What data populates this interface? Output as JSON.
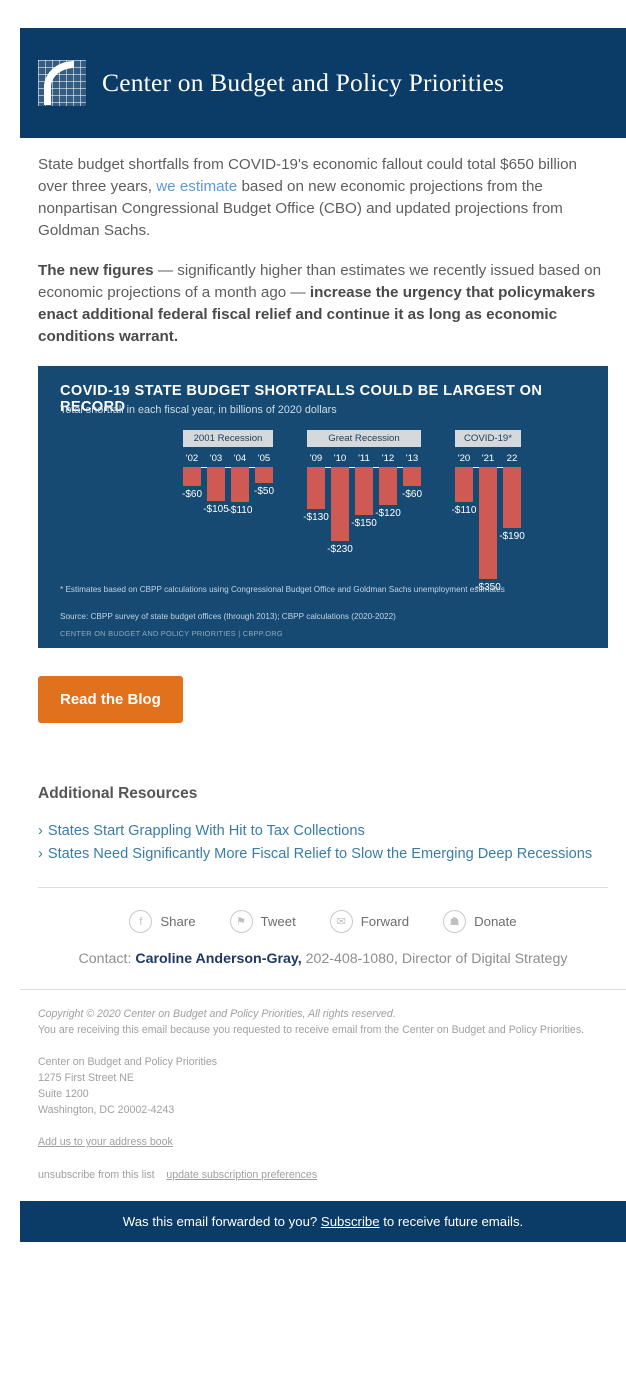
{
  "header": {
    "org_name": "Center on Budget and Policy Priorities",
    "logo_icon": "cbpp-grid-arc-logo"
  },
  "body": {
    "para1_a": "State budget shortfalls from COVID-19's economic fallout could total $650 billion over three years, ",
    "para1_link": "we estimate",
    "para1_b": " based on new economic projections from the nonpartisan Congressional Budget Office (CBO) and updated projections from Goldman Sachs.",
    "para2_bold1": "The new figures",
    "para2_mid": " — significantly higher than estimates we recently issued based on economic projections of a month ago — ",
    "para2_bold2": "increase the urgency that policymakers enact additional federal fiscal relief and continue it as long as economic conditions warrant."
  },
  "cta": {
    "label": "Read the Blog"
  },
  "resources": {
    "title": "Additional Resources",
    "chevron": "›",
    "items": [
      "States Start Grappling With Hit to Tax Collections",
      "States Need Significantly More Fiscal Relief to Slow the Emerging Deep Recessions"
    ]
  },
  "social": [
    {
      "label": "Share",
      "icon": "facebook-icon",
      "glyph": "f"
    },
    {
      "label": "Tweet",
      "icon": "twitter-icon",
      "glyph": "⚑"
    },
    {
      "label": "Forward",
      "icon": "envelope-icon",
      "glyph": "✉"
    },
    {
      "label": "Donate",
      "icon": "gift-icon",
      "glyph": "☗"
    }
  ],
  "contact": {
    "prefix": "Contact: ",
    "name": "Caroline Anderson-Gray,",
    "suffix": " 202-408-1080, Director of Digital Strategy"
  },
  "footer": {
    "copyright": "Copyright © 2020 Center on Budget and Policy Priorities, All rights reserved.",
    "reason": "You are receiving this email because you requested to receive email from the Center on Budget and Policy Priorities.",
    "address": [
      "Center on Budget and Policy Priorities",
      "1275 First Street NE",
      "Suite 1200",
      "Washington, DC 20002-4243"
    ],
    "address_book_link": "Add us to your address book",
    "unsubscribe": "unsubscribe from this list",
    "preferences": "update subscription preferences"
  },
  "banner": {
    "before": "Was this email forwarded to you? ",
    "link": "Subscribe",
    "after": " to receive future emails."
  },
  "chart_data": {
    "type": "bar",
    "title": "COVID-19 STATE BUDGET SHORTFALLS COULD BE LARGEST ON RECORD",
    "subtitle": "Total shortfall in each fiscal year, in billions of 2020 dollars",
    "xlabel": "",
    "ylabel": "",
    "ylim": [
      -350,
      0
    ],
    "grid": false,
    "bar_color": "#cf5a54",
    "background_color": "#164a73",
    "groups": [
      {
        "name": "2001 Recession",
        "categories": [
          "'02",
          "'03",
          "'04",
          "'05"
        ],
        "values": [
          -60,
          -105,
          -110,
          -50
        ],
        "labels": [
          "-$60",
          "-$105",
          "-$110",
          "-$50"
        ]
      },
      {
        "name": "Great Recession",
        "categories": [
          "'09",
          "'10",
          "'11",
          "'12",
          "'13"
        ],
        "values": [
          -130,
          -230,
          -150,
          -120,
          -60
        ],
        "labels": [
          "-$130",
          "-$230",
          "-$150",
          "-$120",
          "-$60"
        ]
      },
      {
        "name": "COVID-19*",
        "categories": [
          "'20",
          "'21",
          "22"
        ],
        "values": [
          -110,
          -350,
          -190
        ],
        "labels": [
          "-$110",
          "-$350",
          "-$190"
        ]
      }
    ],
    "notes": [
      "* Estimates based on CBPP calculations using Congressional Budget Office and Goldman Sachs unemployment estimates",
      "Source: CBPP survey of state budget offices (through 2013); CBPP calculations (2020-2022)",
      "CENTER ON BUDGET AND POLICY PRIORITIES | CBPP.ORG"
    ]
  }
}
